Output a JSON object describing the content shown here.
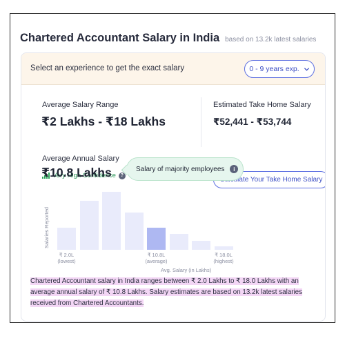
{
  "header": {
    "title": "Chartered Accountant Salary in India",
    "subtitle": "based on 13.2k latest salaries"
  },
  "experience_bar": {
    "prompt": "Select an experience to get the exact salary",
    "selected": "0 - 9 years exp.",
    "icon": "chevron-down-icon"
  },
  "average_range": {
    "label": "Average Salary Range",
    "value": "₹2 Lakhs - ₹18 Lakhs",
    "confidence": "Very High Confidence",
    "confidence_icon": "signal-bars-icon",
    "confidence_color": "#1f8f4e"
  },
  "take_home": {
    "label": "Estimated Take Home Salary",
    "value": "₹52,441 - ₹53,744",
    "button": "Calculate Your Take Home Salary"
  },
  "annual": {
    "label": "Average Annual Salary",
    "value": "₹10.8 Lakhs",
    "tooltip": "Salary of majority employees"
  },
  "chart_data": {
    "type": "bar",
    "ylabel": "Salaries Reported",
    "xlabel": "Avg. Salary (in Lakhs)",
    "values": [
      25,
      55,
      65,
      42,
      25,
      18,
      10,
      4
    ],
    "highlight_index": 4,
    "ylim": [
      0,
      70
    ],
    "tick_labels": [
      {
        "index": 0,
        "value": "₹ 2.0L",
        "note": "(lowest)"
      },
      {
        "index": 4,
        "value": "₹ 10.8L",
        "note": "(average)"
      },
      {
        "index": 7,
        "value": "₹ 18.0L",
        "note": "(highest)"
      }
    ],
    "colors": {
      "bar": "#e9ebfb",
      "highlight": "#aeb8f2"
    }
  },
  "summary": "Chartered Accountant salary in India ranges between ₹ 2.0 Lakhs to ₹ 18.0 Lakhs with an average annual salary of ₹ 10.8 Lakhs. Salary estimates are based on 13.2k latest salaries received from Chartered Accountants."
}
